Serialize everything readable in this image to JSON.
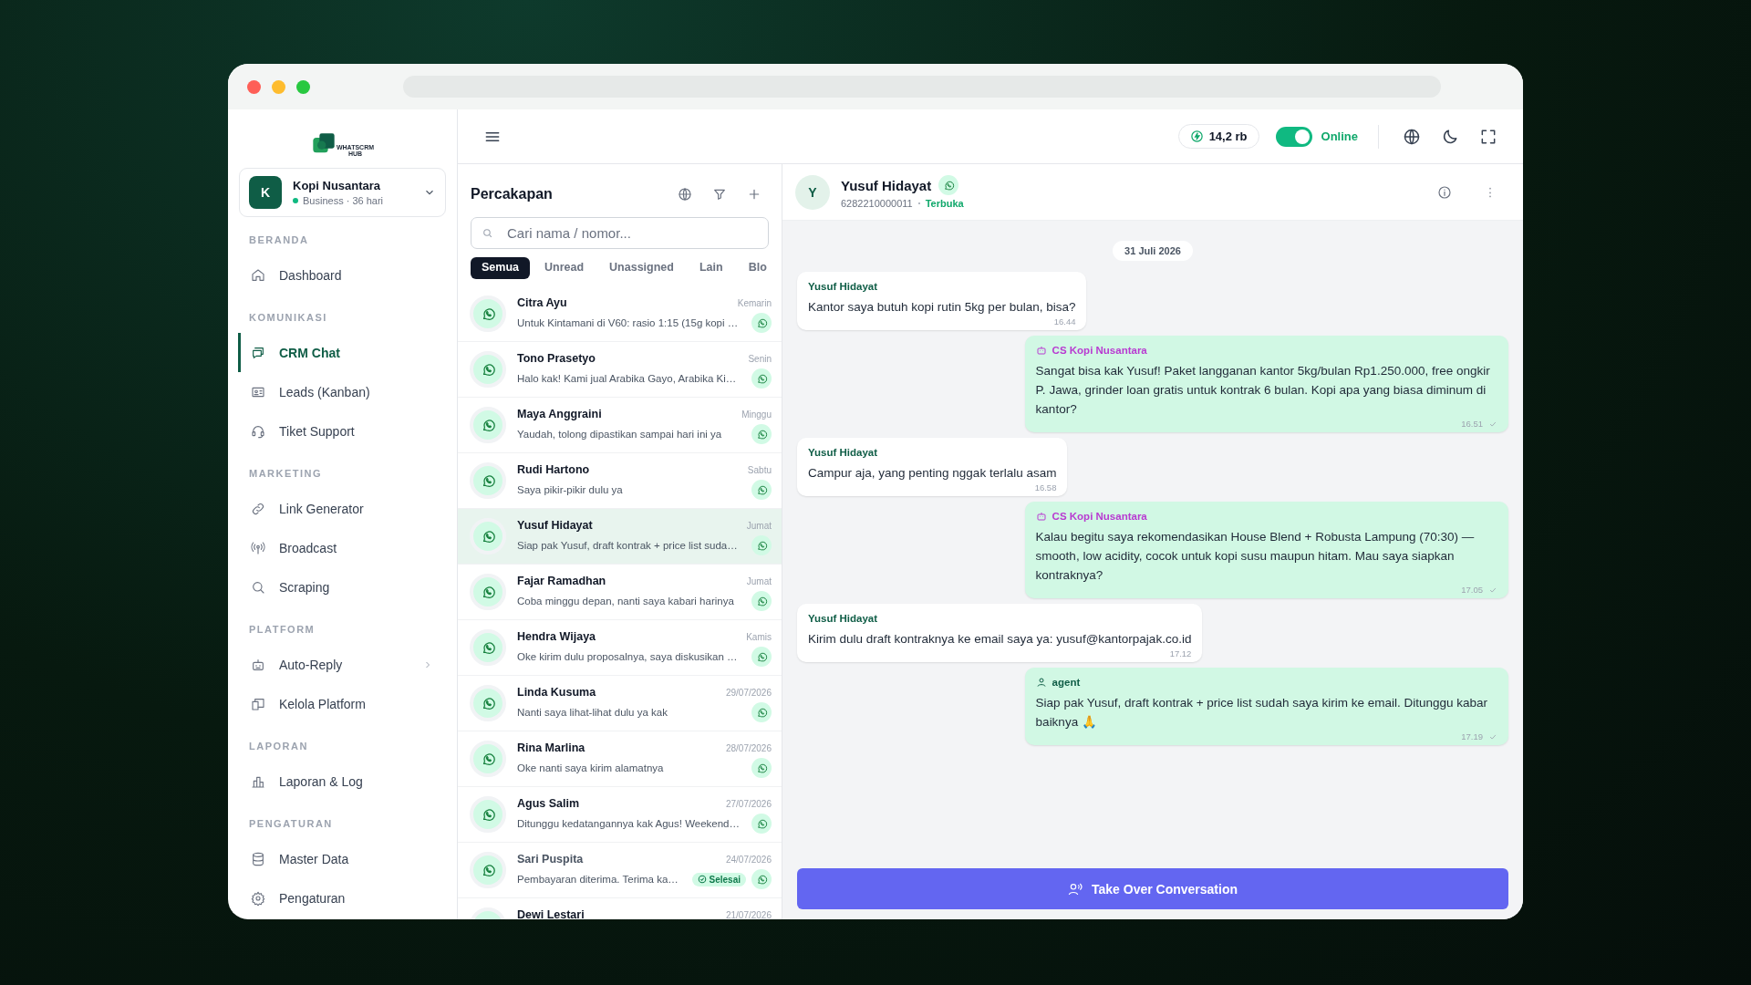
{
  "logo_text": [
    "WHATSCRM",
    "HUB"
  ],
  "account": {
    "initial": "K",
    "name": "Kopi Nusantara",
    "plan": "Business · 36 hari"
  },
  "nav": [
    {
      "title": "BERANDA",
      "items": [
        {
          "label": "Dashboard",
          "selected": false
        }
      ]
    },
    {
      "title": "KOMUNIKASI",
      "items": [
        {
          "label": "CRM Chat",
          "selected": true
        },
        {
          "label": "Leads (Kanban)",
          "selected": false
        },
        {
          "label": "Tiket Support",
          "selected": false
        }
      ]
    },
    {
      "title": "MARKETING",
      "items": [
        {
          "label": "Link Generator",
          "selected": false
        },
        {
          "label": "Broadcast",
          "selected": false
        },
        {
          "label": "Scraping",
          "selected": false
        }
      ]
    },
    {
      "title": "PLATFORM",
      "items": [
        {
          "label": "Auto-Reply",
          "selected": false,
          "submenu": true
        },
        {
          "label": "Kelola Platform",
          "selected": false
        }
      ]
    },
    {
      "title": "LAPORAN",
      "items": [
        {
          "label": "Laporan & Log",
          "selected": false
        }
      ]
    },
    {
      "title": "PENGATURAN",
      "items": [
        {
          "label": "Master Data",
          "selected": false
        },
        {
          "label": "Pengaturan",
          "selected": false
        }
      ]
    }
  ],
  "topbar": {
    "credits": "14,2 rb",
    "online": true,
    "status_label": "Online"
  },
  "conversations": {
    "title": "Percakapan",
    "search": {
      "placeholder": "Cari nama / nomor..."
    },
    "tabs": [
      {
        "label": "Semua",
        "selected": true
      },
      {
        "label": "Unread",
        "selected": false
      },
      {
        "label": "Unassigned",
        "selected": false
      },
      {
        "label": "Lain",
        "selected": false
      },
      {
        "label": "Blo",
        "selected": false
      }
    ],
    "rows": [
      {
        "name": "Citra Ayu",
        "time": "Kemarin",
        "preview": "Untuk Kintamani di V60: rasio 1:15 (15g kopi …",
        "selected": false
      },
      {
        "name": "Tono Prasetyo",
        "time": "Senin",
        "preview": "Halo kak! Kami jual Arabika Gayo, Arabika Ki…",
        "selected": false
      },
      {
        "name": "Maya Anggraini",
        "time": "Minggu",
        "preview": "Yaudah, tolong dipastikan sampai hari ini ya",
        "selected": false
      },
      {
        "name": "Rudi Hartono",
        "time": "Sabtu",
        "preview": "Saya pikir-pikir dulu ya",
        "selected": false
      },
      {
        "name": "Yusuf Hidayat",
        "time": "Jumat",
        "preview": "Siap pak Yusuf, draft kontrak + price list suda…",
        "selected": true
      },
      {
        "name": "Fajar Ramadhan",
        "time": "Jumat",
        "preview": "Coba minggu depan, nanti saya kabari harinya",
        "selected": false
      },
      {
        "name": "Hendra Wijaya",
        "time": "Kamis",
        "preview": "Oke kirim dulu proposalnya, saya diskusikan …",
        "selected": false
      },
      {
        "name": "Linda Kusuma",
        "time": "29/07/2026",
        "preview": "Nanti saya lihat-lihat dulu ya kak",
        "selected": false
      },
      {
        "name": "Rina Marlina",
        "time": "28/07/2026",
        "preview": "Oke nanti saya kirim alamatnya",
        "selected": false
      },
      {
        "name": "Agus Salim",
        "time": "27/07/2026",
        "preview": "Ditunggu kedatangannya kak Agus! Weekend…",
        "selected": false
      },
      {
        "name": "Sari Puspita",
        "time": "24/07/2026",
        "preview": "Pembayaran diterima. Terima ka…",
        "badge": "Selesai",
        "selected": false
      },
      {
        "name": "Dewi Lestari",
        "time": "21/07/2026",
        "selected": false
      }
    ]
  },
  "chat": {
    "initial": "Y",
    "name": "Yusuf Hidayat",
    "phone": "6282210000011",
    "status": "Terbuka",
    "date": "31 Juli 2026",
    "messages": [
      {
        "kind": "contact",
        "sender": "Yusuf Hidayat",
        "text": "Kantor saya butuh kopi rutin 5kg per bulan, bisa?",
        "time": "16.44"
      },
      {
        "kind": "bot",
        "sender": "CS Kopi Nusantara",
        "text": "Sangat bisa kak Yusuf! Paket langganan kantor 5kg/bulan Rp1.250.000, free ongkir P. Jawa, grinder loan gratis untuk kontrak 6 bulan. Kopi apa yang biasa diminum di kantor?",
        "time": "16.51",
        "sent": true
      },
      {
        "kind": "contact",
        "sender": "Yusuf Hidayat",
        "text": "Campur aja, yang penting nggak terlalu asam",
        "time": "16.58"
      },
      {
        "kind": "bot",
        "sender": "CS Kopi Nusantara",
        "text": "Kalau begitu saya rekomendasikan House Blend + Robusta Lampung (70:30) — smooth, low acidity, cocok untuk kopi susu maupun hitam. Mau saya siapkan kontraknya?",
        "time": "17.05",
        "sent": true
      },
      {
        "kind": "contact",
        "sender": "Yusuf Hidayat",
        "text": "Kirim dulu draft kontraknya ke email saya ya: yusuf@kantorpajak.co.id",
        "time": "17.12"
      },
      {
        "kind": "agent",
        "sender": "agent",
        "text": "Siap pak Yusuf, draft kontrak + price list sudah saya kirim ke email. Ditunggu kabar baiknya 🙏",
        "time": "17.19",
        "sent": true
      }
    ],
    "action": "Take Over Conversation"
  }
}
